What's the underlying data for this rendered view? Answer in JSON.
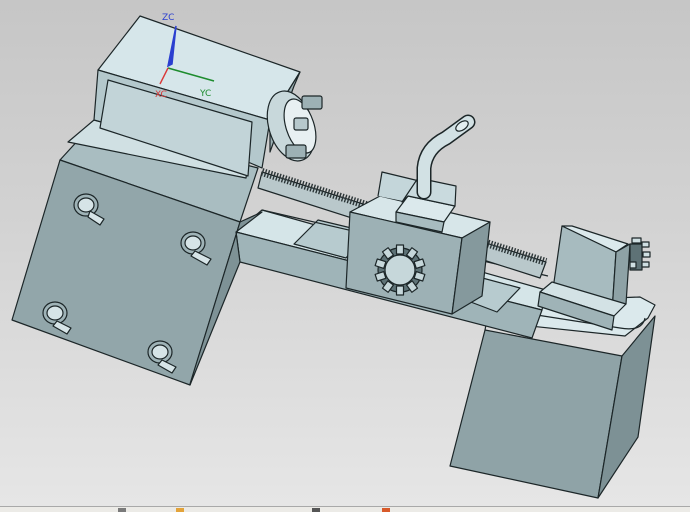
{
  "viewport": {
    "axes": {
      "zc": "ZC",
      "xc": "XC",
      "yc": "YC"
    },
    "colors": {
      "zc_axis": "#2b3fd0",
      "xc_axis": "#d93a3a",
      "yc_axis": "#1e8c2e",
      "body_face": "#98aeb2",
      "body_top": "#d6e6ea",
      "edge": "#1c2628"
    }
  },
  "statusbar": {
    "icons": [
      "tool-icon",
      "folder-icon",
      "view-icon",
      "snap-icon"
    ]
  }
}
